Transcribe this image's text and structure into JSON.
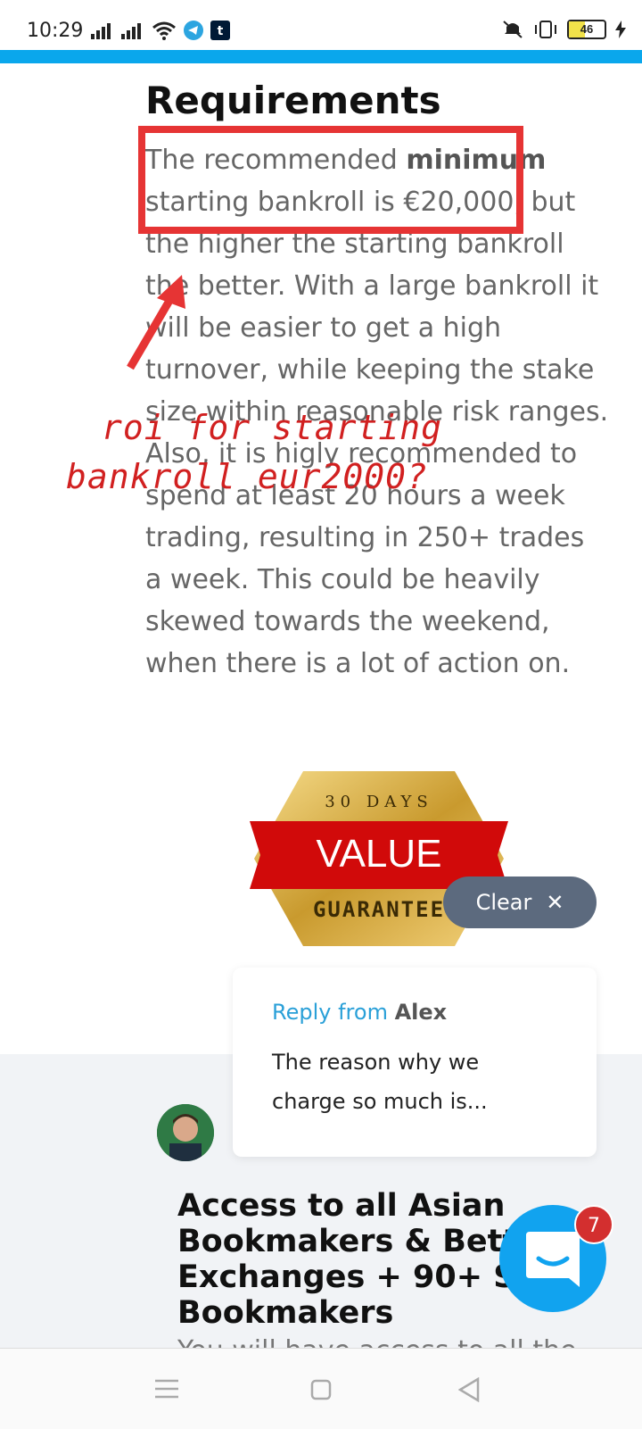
{
  "status_bar": {
    "time": "10:29",
    "battery": "46",
    "colors": {
      "icon": "#222222",
      "battery_fill": "#f1e14a",
      "telegram": "#2ca5e0",
      "tumblr": "#001935"
    }
  },
  "theme": {
    "accent": "#0aa7ec",
    "annotation_red": "#e63434",
    "clear_bg": "#5c6a7e",
    "chat_fab": "#11a3ef",
    "chat_badge": "#d32f2f"
  },
  "content": {
    "title": "Requirements",
    "para_before_bold": "The recommended ",
    "para_bold": "minimum",
    "para_after_bold": " starting bankroll is €20,000, but the higher the starting bankroll the better. With a large bankroll it will be easier to get a high turnover, while keeping the stake size within reasonable risk ranges. Also, it is higly recommended to spend at least 20 hours a week trading, resulting in 250+ trades a week. This could be heavily skewed towards the weekend, when there is a lot of action on."
  },
  "annotation": {
    "line1": "roi for starting",
    "line2": "bankroll eur2000?"
  },
  "badge": {
    "top": "30 DAYS",
    "middle": "VALUE",
    "bottom": "GUARANTEE"
  },
  "clear_button": {
    "label": "Clear"
  },
  "reply": {
    "from_label": "Reply from",
    "from_name": "Alex",
    "message": "The reason why we charge so much is..."
  },
  "section2": {
    "title": "Access to all Asian Bookmakers & Betting Exchanges + 90+ Soft Bookmakers",
    "cut_text": "You will have access to all the"
  },
  "chat": {
    "unread": "7"
  }
}
